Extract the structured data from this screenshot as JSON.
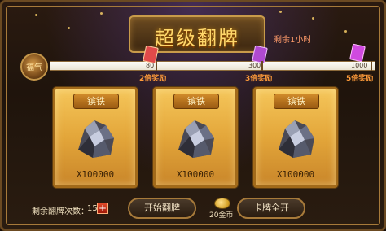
{
  "title": "超级翻牌",
  "timer_text": "剩余1小时",
  "progress": {
    "badge_text": "福气",
    "markers": [
      {
        "value": "80",
        "reward": "2倍奖励"
      },
      {
        "value": "300",
        "reward": "3倍奖励"
      },
      {
        "value": "1000",
        "reward": "5倍奖励"
      }
    ]
  },
  "cards": [
    {
      "name": "镔铁",
      "quantity": "X100000"
    },
    {
      "name": "镔铁",
      "quantity": "X100000"
    },
    {
      "name": "镔铁",
      "quantity": "X100000"
    }
  ],
  "footer": {
    "remaining_label": "剩余翻牌次数：",
    "remaining_count": "15",
    "plus_symbol": "+",
    "start_button": "开始翻牌",
    "cost_text": "20金币",
    "reveal_button": "卡牌全开"
  },
  "colors": {
    "gold": "#ffd76a",
    "card_gold": "#f5c65a",
    "frame": "#a77a3a"
  },
  "icons": {
    "badge": "fortune-badge-icon",
    "ore": "iron-ore-icon",
    "coin": "gold-coin-icon",
    "ticket": "reward-ticket-icon",
    "plus": "plus-icon"
  }
}
